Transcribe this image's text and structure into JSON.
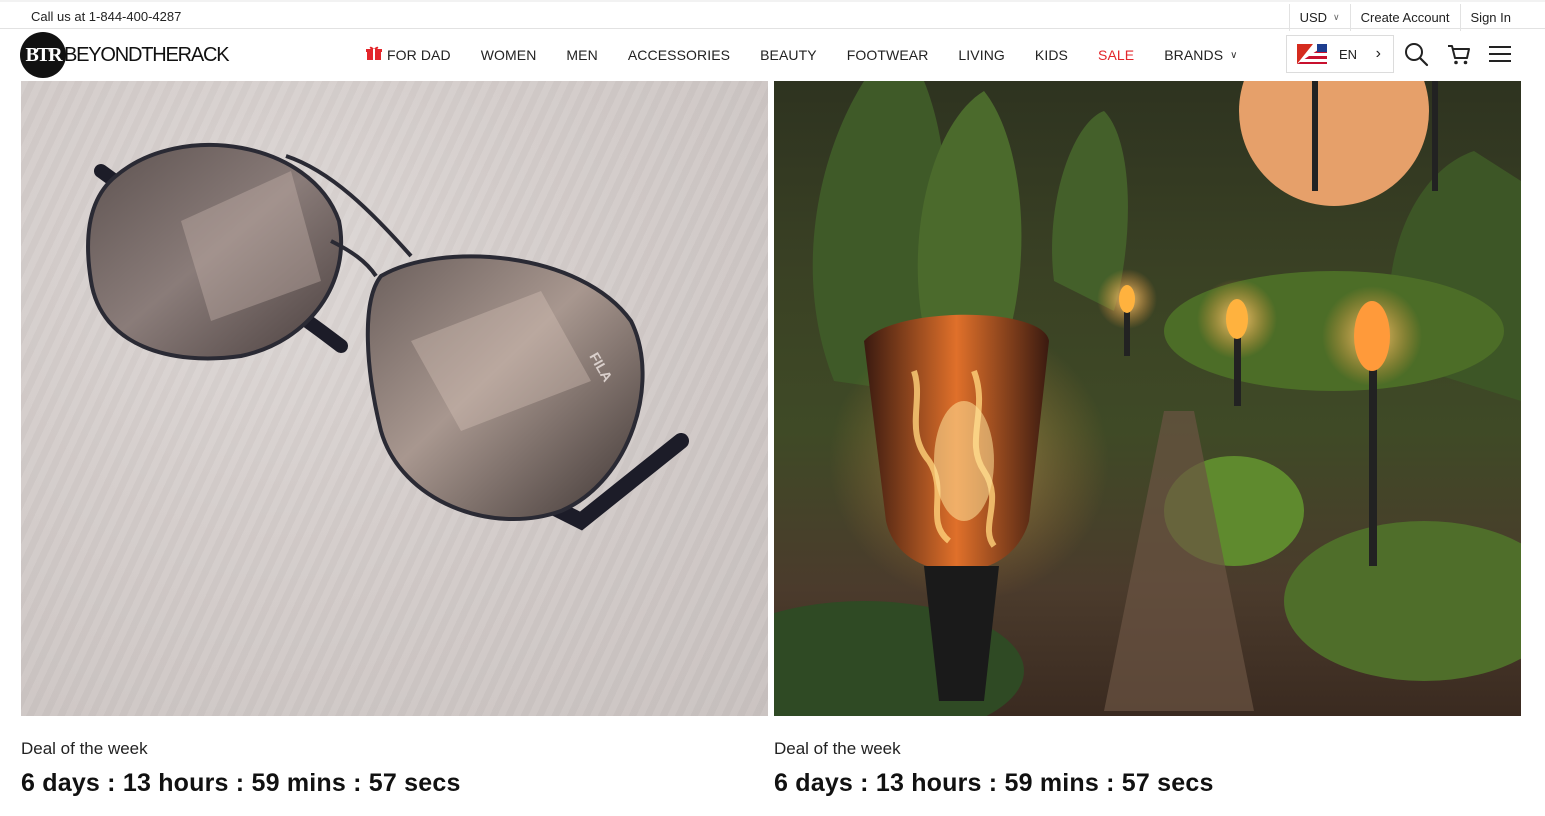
{
  "topbar": {
    "phone": "Call us at 1-844-400-4287",
    "currency": "USD",
    "create_account": "Create Account",
    "sign_in": "Sign In"
  },
  "header": {
    "logo_mark": "BTR",
    "logo_text": "BEYONDTHERACK",
    "nav": [
      {
        "label": "FOR DAD",
        "icon": "gift-icon"
      },
      {
        "label": "WOMEN"
      },
      {
        "label": "MEN"
      },
      {
        "label": "ACCESSORIES"
      },
      {
        "label": "BEAUTY"
      },
      {
        "label": "FOOTWEAR"
      },
      {
        "label": "LIVING"
      },
      {
        "label": "KIDS"
      },
      {
        "label": "SALE",
        "color": "#e3262b"
      },
      {
        "label": "BRANDS",
        "icon": "chevron-down-icon"
      }
    ],
    "language": "EN",
    "icons": [
      "search-icon",
      "cart-icon",
      "menu-icon"
    ]
  },
  "deals": [
    {
      "image": "sunglasses-photo",
      "label": "Deal of the week",
      "timer": "6 days : 13 hours : 59 mins : 57 secs"
    },
    {
      "image": "garden-torch-photo",
      "label": "Deal of the week",
      "timer": "6 days : 13 hours : 59 mins : 57 secs"
    }
  ],
  "colors": {
    "sale": "#e3262b",
    "border": "#e2e2e2",
    "text": "#222222"
  }
}
